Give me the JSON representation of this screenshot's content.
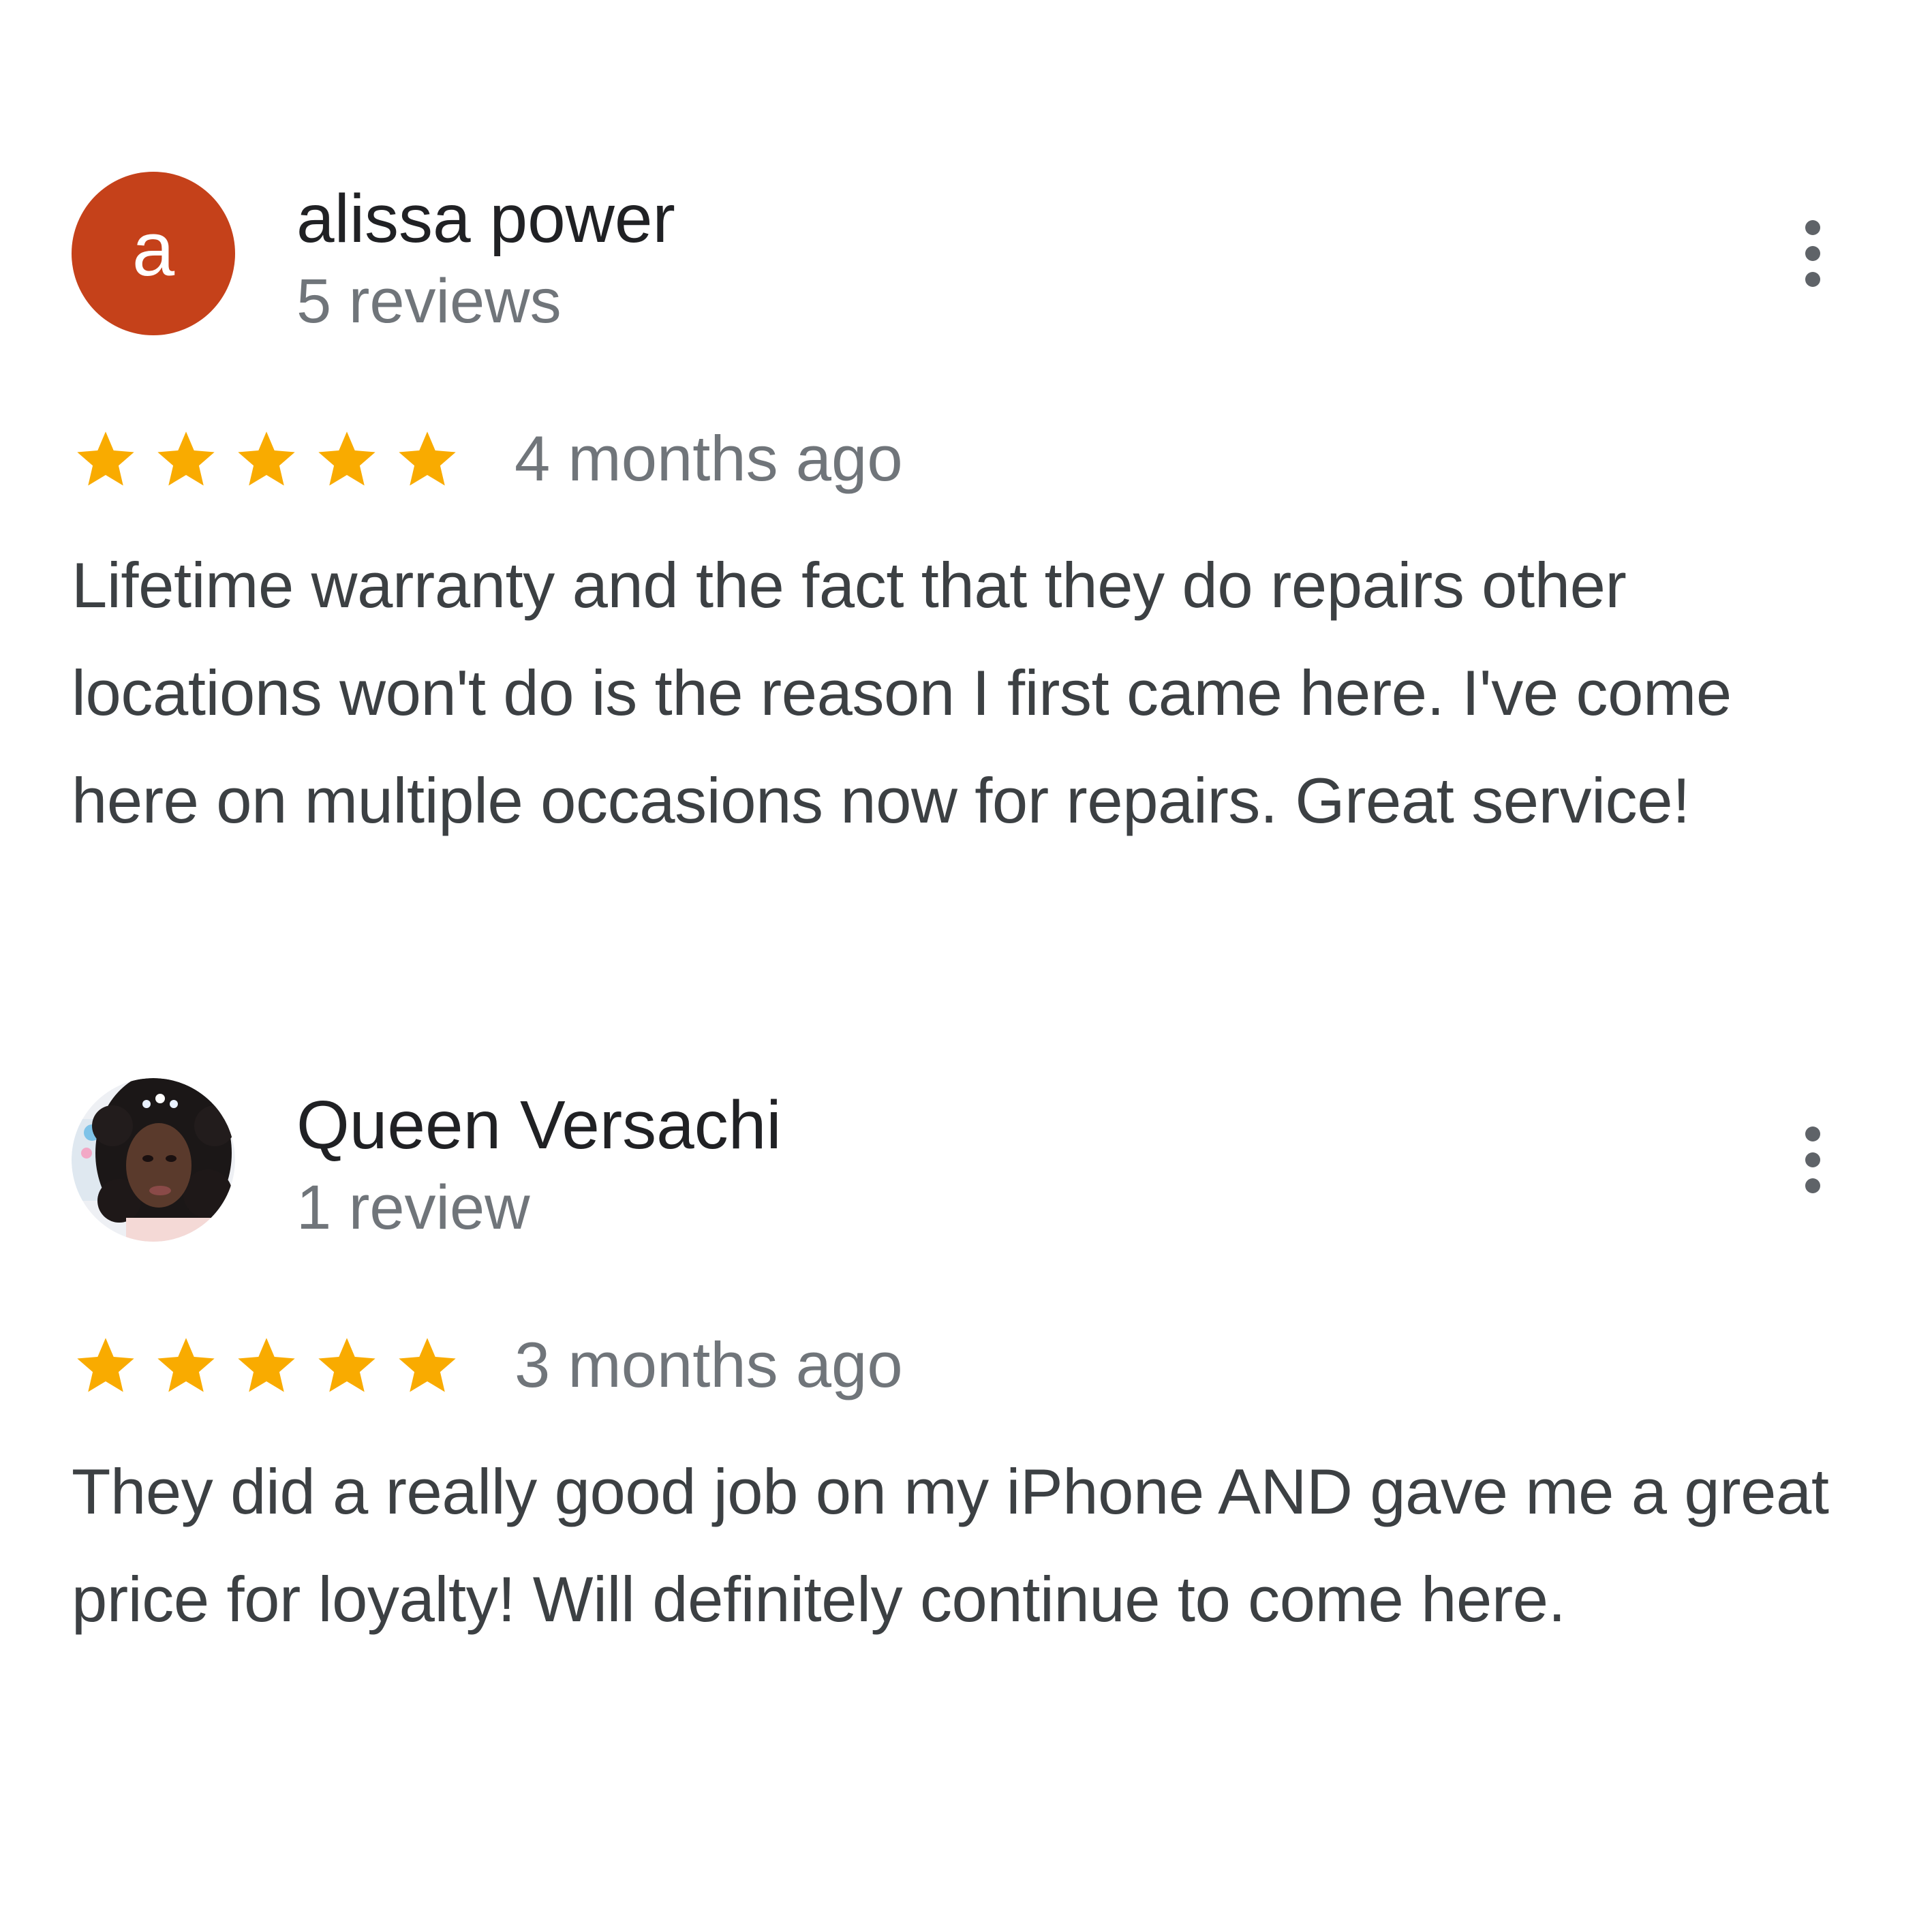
{
  "reviews": [
    {
      "author": "alissa power",
      "review_count": "5 reviews",
      "avatar": {
        "type": "letter",
        "letter": "a",
        "color": "#c5411a"
      },
      "rating": 5,
      "time": "4 months ago",
      "text": "Lifetime warranty and the fact that they do repairs other locations won't do is the reason I first came here. I've come here on multiple occasions now for repairs. Great service!",
      "menu_icon": "more-vert-icon"
    },
    {
      "author": "Queen Versachi",
      "review_count": "1 review",
      "avatar": {
        "type": "photo"
      },
      "rating": 5,
      "time": "3 months ago",
      "text": "They did a really good job on my iPhone AND gave me a great price for loyalty! Will definitely continue to come here.",
      "menu_icon": "more-vert-icon"
    }
  ],
  "colors": {
    "star": "#f9ab00",
    "name": "#202124",
    "secondary": "#70757a",
    "body": "#3c4043"
  }
}
